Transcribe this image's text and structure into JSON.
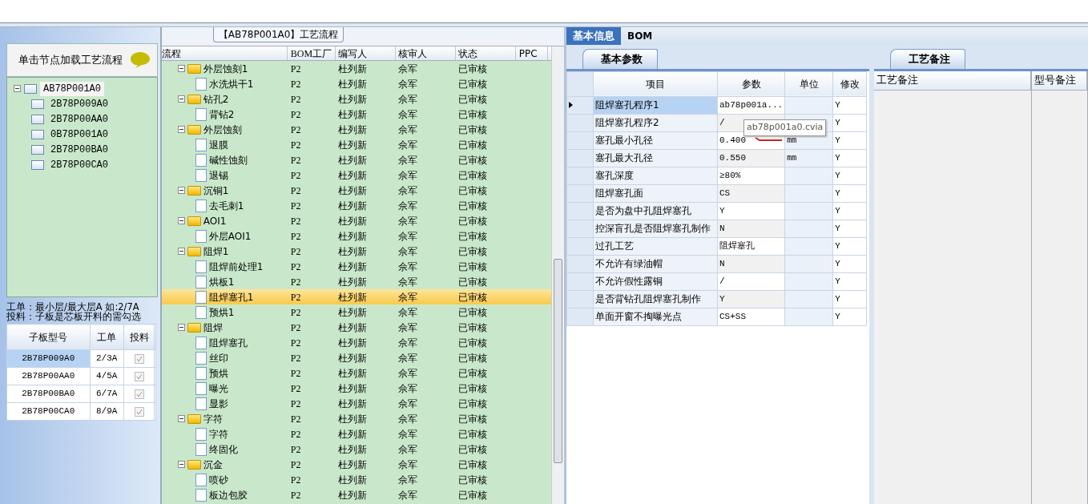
{
  "left_panel": {
    "header": "单击节点加载工艺流程",
    "tree": [
      {
        "label": "AB78P001A0",
        "expanded": true,
        "selected": true,
        "children": [
          {
            "label": "2B78P009A0",
            "selected": false
          },
          {
            "label": "2B78P00AA0",
            "selected": false
          },
          {
            "label": "0B78P001A0",
            "selected": false
          },
          {
            "label": "2B78P00BA0",
            "selected": false
          },
          {
            "label": "2B78P00CA0",
            "selected": false
          }
        ]
      }
    ],
    "notes": [
      "工单：最小层/最大层A 如:2/7A",
      "投料：子板是芯板开料的需勾选"
    ],
    "table": {
      "columns": [
        "子板型号",
        "工单",
        "投料"
      ],
      "rows": [
        {
          "board": "2B78P009A0",
          "order": "2/3A",
          "feed": true,
          "selected": true
        },
        {
          "board": "2B78P00AA0",
          "order": "4/5A",
          "feed": true,
          "selected": false
        },
        {
          "board": "2B78P00BA0",
          "order": "6/7A",
          "feed": true,
          "selected": false
        },
        {
          "board": "2B78P00CA0",
          "order": "8/9A",
          "feed": true,
          "selected": false
        }
      ]
    }
  },
  "process_flow": {
    "title": "【AB78P001A0】工艺流程",
    "columns": [
      "流程",
      "BOM工厂",
      "编写人",
      "核审人",
      "状态",
      "PPC"
    ],
    "rows": [
      {
        "label": "外层蚀刻1",
        "factory": "P2",
        "author": "杜列新",
        "reviewer": "佘军",
        "status": "已审核",
        "expanded": true,
        "selected": false,
        "children": [
          {
            "label": "水洗烘干1",
            "factory": "P2",
            "author": "杜列新",
            "reviewer": "佘军",
            "status": "已审核",
            "selected": false
          }
        ]
      },
      {
        "label": "钻孔2",
        "factory": "P2",
        "author": "杜列新",
        "reviewer": "佘军",
        "status": "已审核",
        "expanded": true,
        "selected": false,
        "children": [
          {
            "label": "背钻2",
            "factory": "P2",
            "author": "杜列新",
            "reviewer": "佘军",
            "status": "已审核",
            "selected": false
          }
        ]
      },
      {
        "label": "外层蚀刻",
        "factory": "P2",
        "author": "杜列新",
        "reviewer": "佘军",
        "status": "已审核",
        "expanded": true,
        "selected": false,
        "children": [
          {
            "label": "退膜",
            "factory": "P2",
            "author": "杜列新",
            "reviewer": "佘军",
            "status": "已审核",
            "selected": false
          },
          {
            "label": "碱性蚀刻",
            "factory": "P2",
            "author": "杜列新",
            "reviewer": "佘军",
            "status": "已审核",
            "selected": false
          },
          {
            "label": "退锡",
            "factory": "P2",
            "author": "杜列新",
            "reviewer": "佘军",
            "status": "已审核",
            "selected": false
          }
        ]
      },
      {
        "label": "沉铜1",
        "factory": "P2",
        "author": "杜列新",
        "reviewer": "佘军",
        "status": "已审核",
        "expanded": true,
        "selected": false,
        "children": [
          {
            "label": "去毛刺1",
            "factory": "P2",
            "author": "杜列新",
            "reviewer": "佘军",
            "status": "已审核",
            "selected": false
          }
        ]
      },
      {
        "label": "AOI1",
        "factory": "P2",
        "author": "杜列新",
        "reviewer": "佘军",
        "status": "已审核",
        "expanded": true,
        "selected": false,
        "children": [
          {
            "label": "外层AOI1",
            "factory": "P2",
            "author": "杜列新",
            "reviewer": "佘军",
            "status": "已审核",
            "selected": false
          }
        ]
      },
      {
        "label": "阻焊1",
        "factory": "P2",
        "author": "杜列新",
        "reviewer": "佘军",
        "status": "已审核",
        "expanded": true,
        "selected": false,
        "children": [
          {
            "label": "阻焊前处理1",
            "factory": "P2",
            "author": "杜列新",
            "reviewer": "佘军",
            "status": "已审核",
            "selected": false
          },
          {
            "label": "烘板1",
            "factory": "P2",
            "author": "杜列新",
            "reviewer": "佘军",
            "status": "已审核",
            "selected": false
          },
          {
            "label": "阻焊塞孔1",
            "factory": "P2",
            "author": "杜列新",
            "reviewer": "佘军",
            "status": "已审核",
            "selected": true
          },
          {
            "label": "预烘1",
            "factory": "P2",
            "author": "杜列新",
            "reviewer": "佘军",
            "status": "已审核",
            "selected": false
          }
        ]
      },
      {
        "label": "阻焊",
        "factory": "P2",
        "author": "杜列新",
        "reviewer": "佘军",
        "status": "已审核",
        "expanded": true,
        "selected": false,
        "children": [
          {
            "label": "阻焊塞孔",
            "factory": "P2",
            "author": "杜列新",
            "reviewer": "佘军",
            "status": "已审核",
            "selected": false
          },
          {
            "label": "丝印",
            "factory": "P2",
            "author": "杜列新",
            "reviewer": "佘军",
            "status": "已审核",
            "selected": false
          },
          {
            "label": "预烘",
            "factory": "P2",
            "author": "杜列新",
            "reviewer": "佘军",
            "status": "已审核",
            "selected": false
          },
          {
            "label": "曝光",
            "factory": "P2",
            "author": "杜列新",
            "reviewer": "佘军",
            "status": "已审核",
            "selected": false
          },
          {
            "label": "显影",
            "factory": "P2",
            "author": "杜列新",
            "reviewer": "佘军",
            "status": "已审核",
            "selected": false
          }
        ]
      },
      {
        "label": "字符",
        "factory": "P2",
        "author": "杜列新",
        "reviewer": "佘军",
        "status": "已审核",
        "expanded": true,
        "selected": false,
        "children": [
          {
            "label": "字符",
            "factory": "P2",
            "author": "杜列新",
            "reviewer": "佘军",
            "status": "已审核",
            "selected": false
          },
          {
            "label": "终固化",
            "factory": "P2",
            "author": "杜列新",
            "reviewer": "佘军",
            "status": "已审核",
            "selected": false
          }
        ]
      },
      {
        "label": "沉金",
        "factory": "P2",
        "author": "杜列新",
        "reviewer": "佘军",
        "status": "已审核",
        "expanded": true,
        "selected": false,
        "children": [
          {
            "label": "喷砂",
            "factory": "P2",
            "author": "杜列新",
            "reviewer": "佘军",
            "status": "已审核",
            "selected": false
          },
          {
            "label": "板边包胶",
            "factory": "P2",
            "author": "杜列新",
            "reviewer": "佘军",
            "status": "已审核",
            "selected": false
          }
        ]
      }
    ]
  },
  "detail_tabs": [
    {
      "label": "基本信息",
      "selected": true
    },
    {
      "label": "BOM",
      "selected": false
    }
  ],
  "params_tab": "基本参数",
  "params": {
    "columns": [
      "项目",
      "参数",
      "单位",
      "修改"
    ],
    "rows": [
      {
        "item": "阻焊塞孔程序1",
        "value": "ab78p001a...",
        "unit": "",
        "modify": "Y",
        "selected": true
      },
      {
        "item": "阻焊塞孔程序2",
        "value": "/",
        "unit": "",
        "modify": "Y",
        "selected": false
      },
      {
        "item": "塞孔最小孔径",
        "value": "0.400",
        "unit": "mm",
        "modify": "Y",
        "selected": false
      },
      {
        "item": "塞孔最大孔径",
        "value": "0.550",
        "unit": "mm",
        "modify": "Y",
        "selected": false
      },
      {
        "item": "塞孔深度",
        "value": "≥80%",
        "unit": "",
        "modify": "Y",
        "selected": false
      },
      {
        "item": "阻焊塞孔面",
        "value": "CS",
        "unit": "",
        "modify": "Y",
        "selected": false
      },
      {
        "item": "是否为盘中孔阻焊塞孔",
        "value": "Y",
        "unit": "",
        "modify": "Y",
        "selected": false
      },
      {
        "item": "控深盲孔是否阻焊塞孔制作",
        "value": "N",
        "unit": "",
        "modify": "Y",
        "selected": false
      },
      {
        "item": "过孔工艺",
        "value": "阻焊塞孔",
        "unit": "",
        "modify": "Y",
        "selected": false
      },
      {
        "item": "不允许有绿油帽",
        "value": "N",
        "unit": "",
        "modify": "Y",
        "selected": false
      },
      {
        "item": "不允许假性露铜",
        "value": "/",
        "unit": "",
        "modify": "Y",
        "selected": false
      },
      {
        "item": "是否背钻孔阻焊塞孔制作",
        "value": "Y",
        "unit": "",
        "modify": "Y",
        "selected": false
      },
      {
        "item": "单面开窗不掏曝光点",
        "value": "CS+SS",
        "unit": "",
        "modify": "Y",
        "selected": false
      }
    ]
  },
  "tooltip": "ab78p001a0.cvia",
  "notes_tab": "工艺备注",
  "notes_columns": [
    "工艺备注",
    "型号备注"
  ]
}
